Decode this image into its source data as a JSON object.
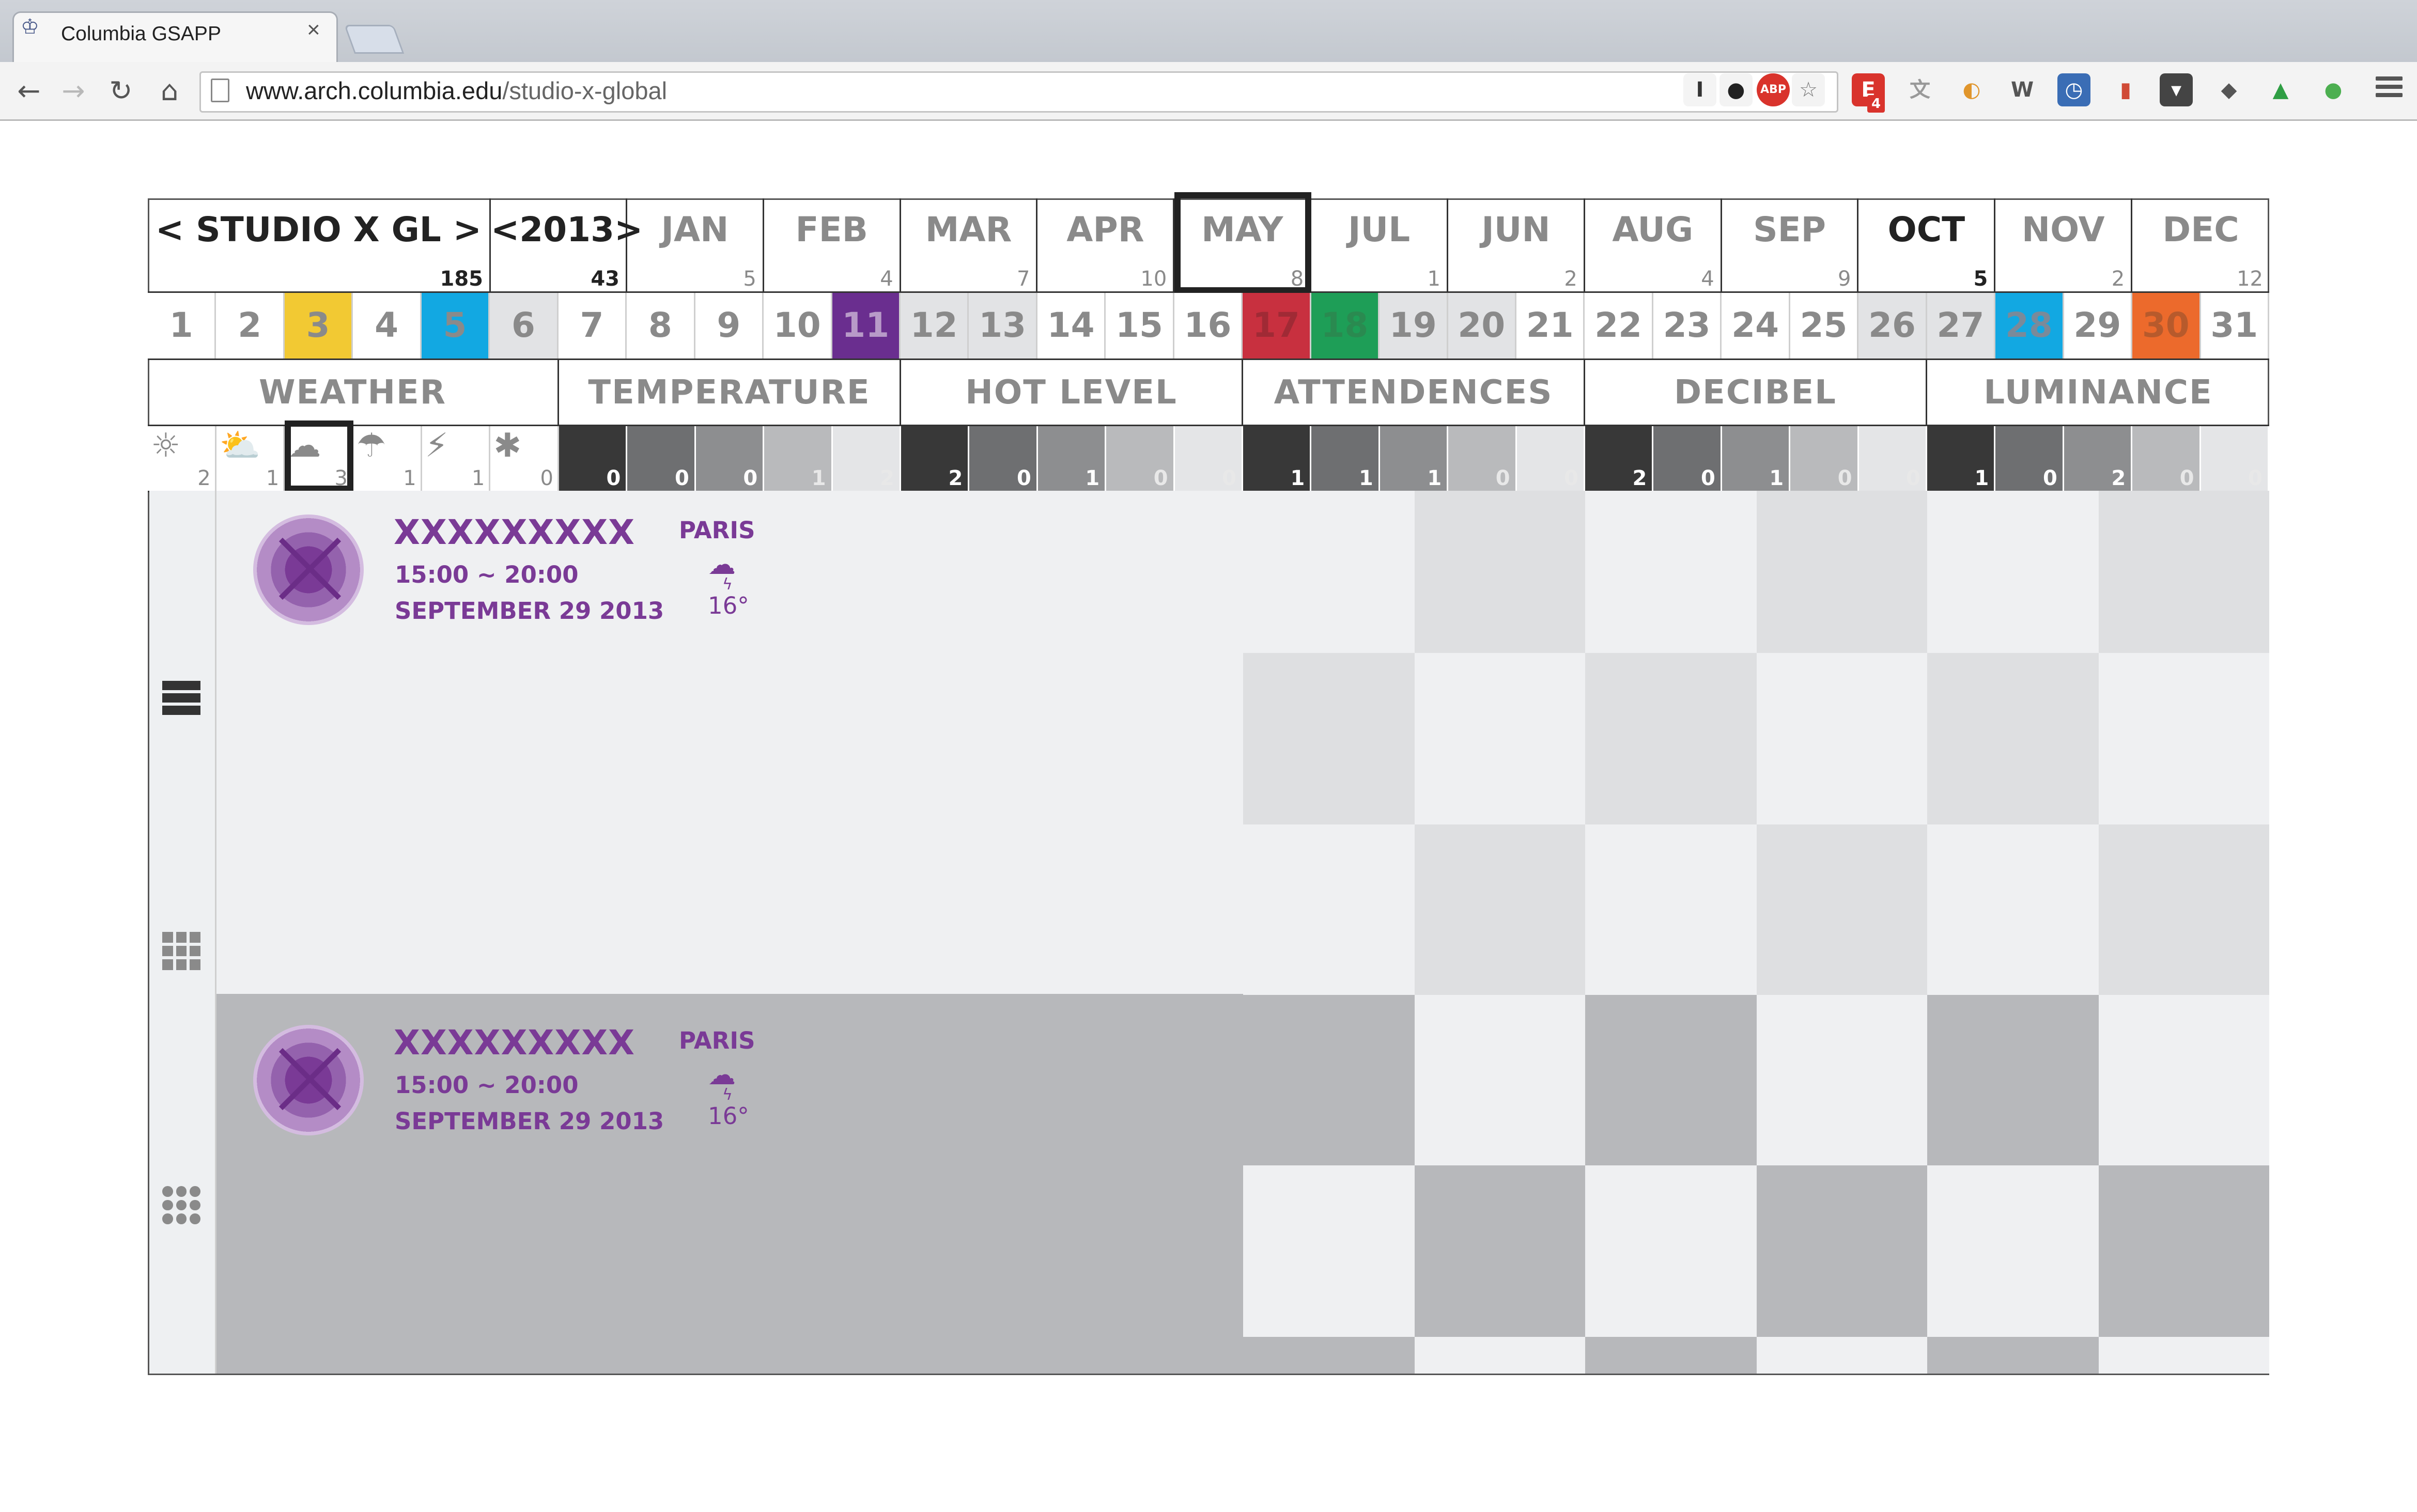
{
  "browser": {
    "tab_title": "Columbia GSAPP",
    "tab_close": "×",
    "url_host": "www.arch.columbia.edu",
    "url_path": "/studio-x-global",
    "back_icon": "←",
    "forward_icon": "→",
    "reload_icon": "↻",
    "home_icon": "⌂",
    "extensions": [
      {
        "name": "instapaper-icon",
        "glyph": "I",
        "bg": "#f4f4f4",
        "color": "#333"
      },
      {
        "name": "ghostery-icon",
        "glyph": "●",
        "bg": "#f3f3f3",
        "color": "#222"
      },
      {
        "name": "adblock-icon",
        "glyph": "ABP",
        "bg": "#d9332c",
        "color": "#fff"
      },
      {
        "name": "bookmark-star-icon",
        "glyph": "☆",
        "bg": "#f3f3f3",
        "color": "#777"
      },
      {
        "name": "evernote-e-icon",
        "glyph": "E",
        "bg": "#d9332c",
        "color": "#fff",
        "badge": "4"
      },
      {
        "name": "translate-icon",
        "glyph": "文",
        "bg": "#f3f3f3",
        "color": "#999"
      },
      {
        "name": "chrome-ext-icon",
        "glyph": "◐",
        "bg": "#f3f3f3",
        "color": "#e0952b"
      },
      {
        "name": "wikipedia-icon",
        "glyph": "W",
        "bg": "#f3f3f3",
        "color": "#555"
      },
      {
        "name": "clock-icon",
        "glyph": "◷",
        "bg": "#3a6db5",
        "color": "#fff"
      },
      {
        "name": "book-icon",
        "glyph": "▮",
        "bg": "#f3f3f3",
        "color": "#d04a36"
      },
      {
        "name": "pocket-icon",
        "glyph": "▾",
        "bg": "#444",
        "color": "#fff"
      },
      {
        "name": "feedly-icon",
        "glyph": "◆",
        "bg": "#f3f3f3",
        "color": "#555"
      },
      {
        "name": "google-drive-icon",
        "glyph": "▲",
        "bg": "#f3f3f3",
        "color": "#2f9e44"
      },
      {
        "name": "evernote-icon",
        "glyph": "●",
        "bg": "#f3f3f3",
        "color": "#4caf50"
      }
    ]
  },
  "header": {
    "studio_label": "<  STUDIO X GL  >",
    "studio_count": "185",
    "year_label": "<2013>",
    "year_count": "43",
    "months": [
      {
        "label": "JAN",
        "count": "5",
        "active": false
      },
      {
        "label": "FEB",
        "count": "4",
        "active": false
      },
      {
        "label": "MAR",
        "count": "7",
        "active": false
      },
      {
        "label": "APR",
        "count": "10",
        "active": false
      },
      {
        "label": "MAY",
        "count": "8",
        "active": false
      },
      {
        "label": "JUL",
        "count": "1",
        "active": false
      },
      {
        "label": "JUN",
        "count": "2",
        "active": false
      },
      {
        "label": "AUG",
        "count": "4",
        "active": false
      },
      {
        "label": "SEP",
        "count": "9",
        "active": false
      },
      {
        "label": "OCT",
        "count": "5",
        "active": true
      },
      {
        "label": "NOV",
        "count": "2",
        "active": false
      },
      {
        "label": "DEC",
        "count": "12",
        "active": false
      }
    ]
  },
  "days": [
    {
      "label": "1",
      "bg": "#ffffff",
      "fg": "#8a8a8a"
    },
    {
      "label": "2",
      "bg": "#ffffff",
      "fg": "#8a8a8a"
    },
    {
      "label": "3",
      "bg": "#f2c933",
      "fg": "#8a8a8a"
    },
    {
      "label": "4",
      "bg": "#ffffff",
      "fg": "#8a8a8a"
    },
    {
      "label": "5",
      "bg": "#12a8e2",
      "fg": "#8a8a8a"
    },
    {
      "label": "6",
      "bg": "#e2e3e5",
      "fg": "#8a8a8a"
    },
    {
      "label": "7",
      "bg": "#ffffff",
      "fg": "#8a8a8a"
    },
    {
      "label": "8",
      "bg": "#ffffff",
      "fg": "#8a8a8a"
    },
    {
      "label": "9",
      "bg": "#ffffff",
      "fg": "#8a8a8a"
    },
    {
      "label": "10",
      "bg": "#ffffff",
      "fg": "#8a8a8a"
    },
    {
      "label": "11",
      "bg": "#6a2e8f",
      "fg": "#b89ac8"
    },
    {
      "label": "12",
      "bg": "#e2e3e5",
      "fg": "#8a8a8a"
    },
    {
      "label": "13",
      "bg": "#e2e3e5",
      "fg": "#8a8a8a"
    },
    {
      "label": "14",
      "bg": "#ffffff",
      "fg": "#8a8a8a"
    },
    {
      "label": "15",
      "bg": "#ffffff",
      "fg": "#8a8a8a"
    },
    {
      "label": "16",
      "bg": "#ffffff",
      "fg": "#8a8a8a"
    },
    {
      "label": "17",
      "bg": "#c8303f",
      "fg": "#a02a35"
    },
    {
      "label": "18",
      "bg": "#1e9e57",
      "fg": "#2a8a50"
    },
    {
      "label": "19",
      "bg": "#e2e3e5",
      "fg": "#8a8a8a"
    },
    {
      "label": "20",
      "bg": "#e2e3e5",
      "fg": "#8a8a8a"
    },
    {
      "label": "21",
      "bg": "#ffffff",
      "fg": "#8a8a8a"
    },
    {
      "label": "22",
      "bg": "#ffffff",
      "fg": "#8a8a8a"
    },
    {
      "label": "23",
      "bg": "#ffffff",
      "fg": "#8a8a8a"
    },
    {
      "label": "24",
      "bg": "#ffffff",
      "fg": "#8a8a8a"
    },
    {
      "label": "25",
      "bg": "#ffffff",
      "fg": "#8a8a8a"
    },
    {
      "label": "26",
      "bg": "#e2e3e5",
      "fg": "#8a8a8a"
    },
    {
      "label": "27",
      "bg": "#e2e3e5",
      "fg": "#8a8a8a"
    },
    {
      "label": "28",
      "bg": "#12a8e2",
      "fg": "#7a8a9a"
    },
    {
      "label": "29",
      "bg": "#ffffff",
      "fg": "#8a8a8a"
    },
    {
      "label": "30",
      "bg": "#ec6a2c",
      "fg": "#b75a2c"
    },
    {
      "label": "31",
      "bg": "#ffffff",
      "fg": "#8a8a8a"
    }
  ],
  "categories": [
    "WEATHER",
    "TEMPERATURE",
    "HOT LEVEL",
    "ATTENDENCES",
    "DECIBEL",
    "LUMINANCE"
  ],
  "weather": [
    {
      "icon": "sun-icon",
      "glyph": "☼",
      "count": "2"
    },
    {
      "icon": "partly-cloudy-icon",
      "glyph": "⛅",
      "count": "1"
    },
    {
      "icon": "cloud-icon",
      "glyph": "☁",
      "count": "3"
    },
    {
      "icon": "rain-icon",
      "glyph": "☂",
      "count": "1"
    },
    {
      "icon": "thunder-icon",
      "glyph": "⚡",
      "count": "1"
    },
    {
      "icon": "snow-icon",
      "glyph": "✱",
      "count": "0"
    }
  ],
  "levels": {
    "shades": [
      "#383838",
      "#6e6f71",
      "#8d8e90",
      "#b9babc",
      "#e4e5e7"
    ],
    "temperature": [
      "0",
      "0",
      "0",
      "1",
      "2"
    ],
    "hot_level": [
      "2",
      "0",
      "1",
      "0",
      "0"
    ],
    "attendences": [
      "1",
      "1",
      "1",
      "0",
      "0"
    ],
    "decibel": [
      "2",
      "0",
      "1",
      "0",
      "0"
    ],
    "luminance": [
      "1",
      "0",
      "2",
      "0",
      "0"
    ]
  },
  "events": [
    {
      "title": "XXXXXXXXX",
      "time": "15:00 ~ 20:00",
      "date": "SEPTEMBER 29 2013",
      "city": "PARIS",
      "weather_icon": "storm-cloud-icon",
      "temp": "16°"
    },
    {
      "title": "XXXXXXXXX",
      "time": "15:00 ~ 20:00",
      "date": "SEPTEMBER 29 2013",
      "city": "PARIS",
      "weather_icon": "storm-cloud-icon",
      "temp": "16°"
    }
  ],
  "colors": {
    "purple": "#7a3a96",
    "light_tile": "#eff0f2",
    "mid_tile": "#dedfe1",
    "dark_tile": "#b7b8bb"
  }
}
